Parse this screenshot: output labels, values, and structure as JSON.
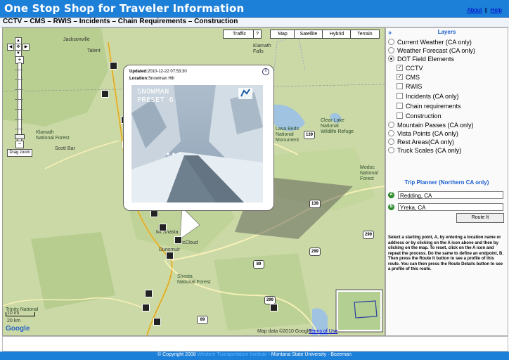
{
  "header": {
    "title": "One Stop Shop for Traveler Information",
    "about": "About",
    "help": "Help",
    "separator": "||"
  },
  "subbar": {
    "text": "CCTV – CMS – RWIS – Incidents – Chain Requirements – Construction"
  },
  "map": {
    "type_buttons": [
      "Traffic",
      "?",
      "Map",
      "Satellite",
      "Hybrid",
      "Terrain"
    ],
    "drag_zoom": "Drag zoom",
    "labels": {
      "jacksonville": "Jacksonville",
      "talent": "Talent",
      "klamath_falls": "Klamath\nFalls",
      "klamath_nf": "Klamath\nNational Forest",
      "scott_bar": "Scott Bar",
      "lava_beds": "Lava Beds\nNational\nMonument",
      "clear_lake": "Clear Lake\nNational\nWildlife Refuge",
      "modoc": "Modoc\nNational\nForest",
      "trinity": "Trinity National",
      "shasta_nf": "Shasta\nNational Forest",
      "mccloud": "McCloud",
      "mount_shasta": "Mt Shasta",
      "dunsmuir": "Dunsmuir",
      "scale_km": "20 km",
      "scale_mi": "10 mi",
      "logo": "Google",
      "attribution": "Map data ©2010 Google",
      "terms": "Terms of Use"
    },
    "shields": [
      "139",
      "139",
      "299",
      "299",
      "89",
      "89",
      "299"
    ],
    "popup": {
      "updated_label": "Updated:",
      "updated_value": "2010-12-22 07:53:30",
      "location_label": "Location:",
      "location_value": "Snowman Hill",
      "overlay_line1": "SNOWMAN",
      "overlay_line2": "PRESET 6",
      "close": "x"
    }
  },
  "sidebar": {
    "collapse": "»",
    "layers_title": "Layers",
    "options": [
      {
        "label": "Current Weather (CA only)",
        "kind": "radio",
        "checked": false
      },
      {
        "label": "Weather Forecast (CA only)",
        "kind": "radio",
        "checked": false
      },
      {
        "label": "DOT Field Elements",
        "kind": "radio",
        "checked": true
      },
      {
        "label": "CCTV",
        "kind": "check",
        "checked": true
      },
      {
        "label": "CMS",
        "kind": "check",
        "checked": true
      },
      {
        "label": "RWIS",
        "kind": "check",
        "checked": false
      },
      {
        "label": "Incidents (CA only)",
        "kind": "check",
        "checked": false
      },
      {
        "label": "Chain requirements",
        "kind": "check",
        "checked": false
      },
      {
        "label": "Construction",
        "kind": "check",
        "checked": false
      },
      {
        "label": "Mountain Passes (CA only)",
        "kind": "radio",
        "checked": false
      },
      {
        "label": "Vista Points (CA only)",
        "kind": "radio",
        "checked": false
      },
      {
        "label": "Rest Areas(CA only)",
        "kind": "radio",
        "checked": false
      },
      {
        "label": "Truck Scales (CA only)",
        "kind": "radio",
        "checked": false
      }
    ],
    "trip_title": "Trip Planner (Northern CA only)",
    "point_a": {
      "marker": "A",
      "value": "Redding, CA"
    },
    "point_b": {
      "marker": "B",
      "value": "Yreka, CA"
    },
    "route_button": "Route It",
    "help_text": "Select a starting point, A, by entering a location name or address or by clicking on the A icon above and then by clicking on the map. To reset, click on the A icon and repeat the process. Do the same to define an endpoint, B. Then press the Route It button to see a profile of this route. You can then press the Route Details button to see a profile of this route."
  },
  "footer": {
    "prefix": "© Copyright 2008",
    "link1": "Western Transportation Institute",
    "sep": " - ",
    "link2": "Montana State University - Bozeman"
  }
}
